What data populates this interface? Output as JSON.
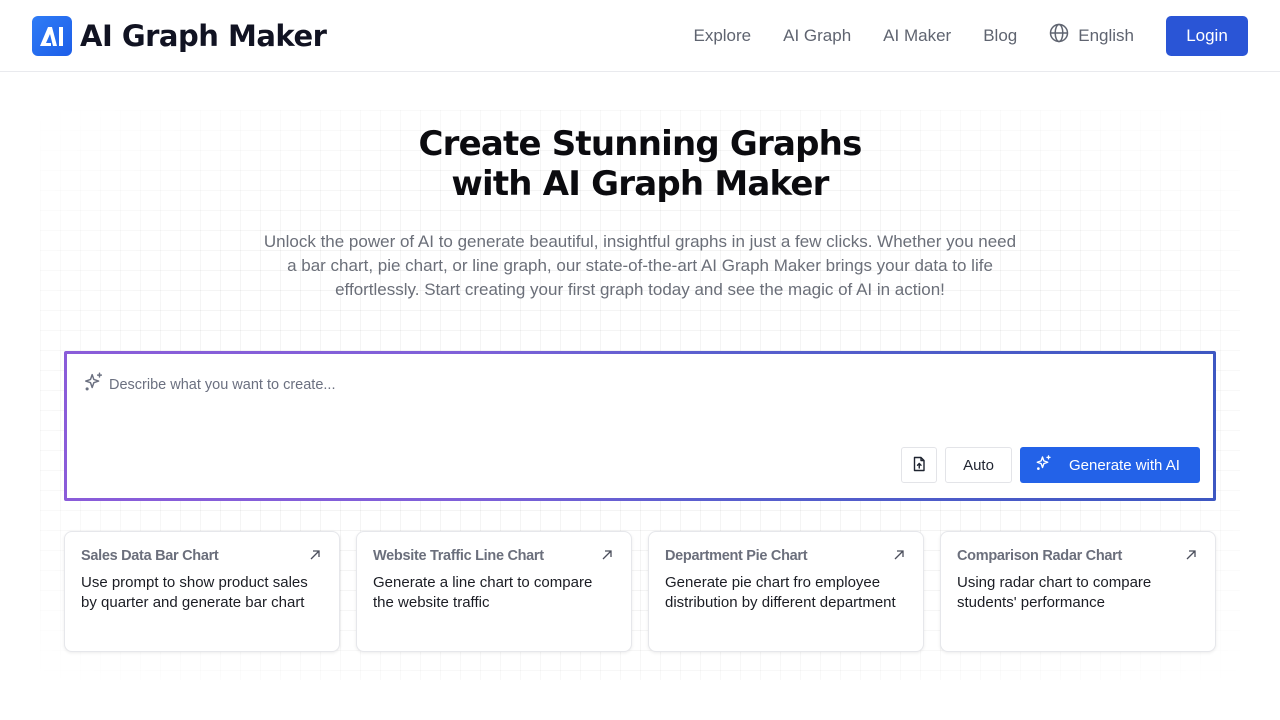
{
  "header": {
    "logo_text": "AI",
    "brand_name": "AI Graph Maker",
    "nav": [
      {
        "label": "Explore"
      },
      {
        "label": "AI Graph"
      },
      {
        "label": "AI Maker"
      },
      {
        "label": "Blog"
      }
    ],
    "language": {
      "icon": "globe-icon",
      "label": "English"
    },
    "login_label": "Login"
  },
  "hero": {
    "title_line1": "Create Stunning Graphs",
    "title_line2": "with AI Graph Maker",
    "subtitle": "Unlock the power of AI to generate beautiful, insightful graphs in just a few clicks. Whether you need a bar chart, pie chart, or line graph, our state-of-the-art AI Graph Maker brings your data to life effortlessly. Start creating your first graph today and see the magic of AI in action!"
  },
  "prompt": {
    "icon": "sparkles-icon",
    "value": "",
    "placeholder": "Describe what you want to create...",
    "upload_icon": "file-upload-icon",
    "mode_label": "Auto",
    "generate_label": "Generate with AI",
    "accent_color": "#2362e8"
  },
  "examples": [
    {
      "title": "Sales Data Bar Chart",
      "description": "Use prompt to show product sales by quarter and generate bar chart",
      "icon": "arrow-up-right-icon"
    },
    {
      "title": "Website Traffic Line Chart",
      "description": "Generate a line chart to compare the website traffic",
      "icon": "arrow-up-right-icon"
    },
    {
      "title": "Department Pie Chart",
      "description": "Generate pie chart fro employee distribution by different department",
      "icon": "arrow-up-right-icon"
    },
    {
      "title": "Comparison Radar Chart",
      "description": "Using radar chart to compare students' performance",
      "icon": "arrow-up-right-icon"
    }
  ],
  "colors": {
    "login_button": "#2a55d6",
    "logo": "#1d5ee8",
    "border_gradient_start": "#8a5cd9",
    "border_gradient_end": "#3d57c2"
  }
}
